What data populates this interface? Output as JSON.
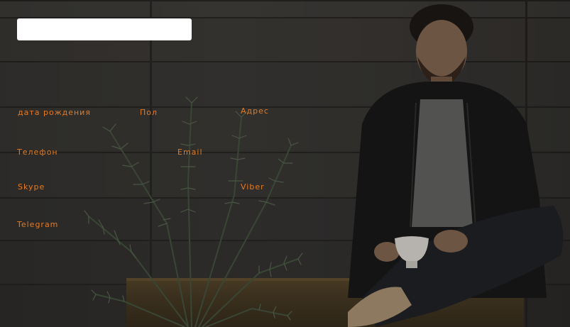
{
  "search": {
    "value": "",
    "placeholder": ""
  },
  "fields": {
    "birth_date": "дата рождения",
    "gender": "Пол",
    "address": "Адрес",
    "phone": "Телефон",
    "email": "Email",
    "skype": "Skype",
    "viber": "Viber",
    "telegram": "Telegram"
  },
  "colors": {
    "label": "#e87a1f",
    "background": "#3d3b38",
    "search_box": "#ffffff"
  },
  "background_image": {
    "description_icon": "photo-icon"
  }
}
